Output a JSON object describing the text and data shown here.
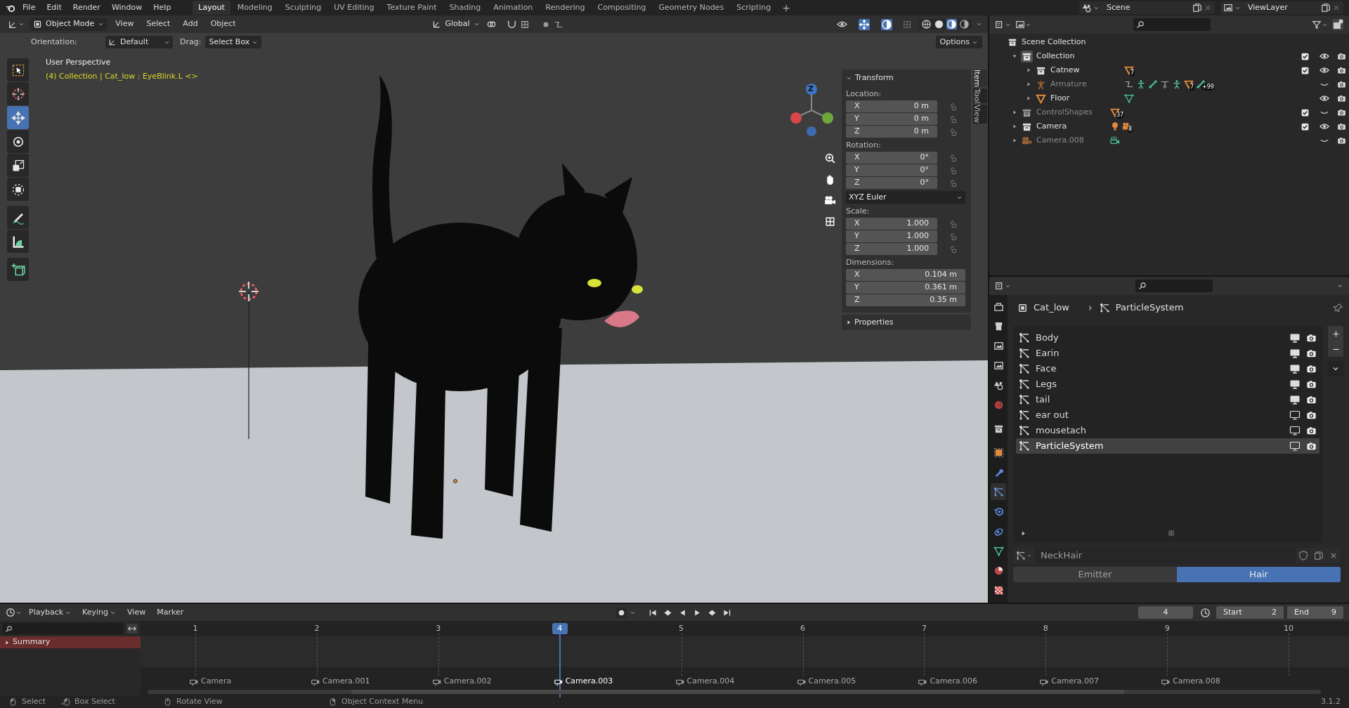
{
  "top_bar": {
    "menus": [
      "File",
      "Edit",
      "Render",
      "Window",
      "Help"
    ],
    "workspaces": [
      {
        "label": "Layout",
        "selected": true
      },
      {
        "label": "Modeling",
        "selected": false
      },
      {
        "label": "Sculpting",
        "selected": false
      },
      {
        "label": "UV Editing",
        "selected": false
      },
      {
        "label": "Texture Paint",
        "selected": false
      },
      {
        "label": "Shading",
        "selected": false
      },
      {
        "label": "Animation",
        "selected": false
      },
      {
        "label": "Rendering",
        "selected": false
      },
      {
        "label": "Compositing",
        "selected": false
      },
      {
        "label": "Geometry Nodes",
        "selected": false
      },
      {
        "label": "Scripting",
        "selected": false
      }
    ],
    "add_workspace": "+",
    "scene": "Scene",
    "view_layer": "ViewLayer"
  },
  "viewport_header": {
    "mode": "Object Mode",
    "menus": [
      "View",
      "Select",
      "Add",
      "Object"
    ],
    "transform_orientation": "Global"
  },
  "tool_settings": {
    "orientation_label": "Orientation:",
    "orientation": "Default",
    "drag_label": "Drag:",
    "drag": "Select Box",
    "options": "Options"
  },
  "toolbar": [
    {
      "kind": "select",
      "selected": false
    },
    {
      "kind": "cursor",
      "selected": false
    },
    {
      "kind": "move",
      "selected": true
    },
    {
      "kind": "rotate",
      "selected": false
    },
    {
      "kind": "scale",
      "selected": false
    },
    {
      "kind": "transform",
      "selected": false
    },
    {
      "kind": "annotate",
      "selected": false
    },
    {
      "kind": "measure",
      "selected": false
    },
    {
      "kind": "add-cube",
      "selected": false
    }
  ],
  "viewport": {
    "view_name": "User Perspective",
    "context": "(4) Collection | Cat_low : EyeBlink.L <>",
    "gizmo_axis_label": "Z"
  },
  "sidebar": {
    "tabs": [
      {
        "label": "Item",
        "selected": true
      },
      {
        "label": "Tool",
        "selected": false
      },
      {
        "label": "View",
        "selected": false
      }
    ],
    "panel_title": "Transform",
    "expanded": true,
    "groups": [
      {
        "label": "Location:",
        "lockable": true,
        "fields": [
          {
            "axis": "X",
            "value": "0 m"
          },
          {
            "axis": "Y",
            "value": "0 m"
          },
          {
            "axis": "Z",
            "value": "0 m"
          }
        ]
      },
      {
        "label": "Rotation:",
        "lockable": true,
        "fields": [
          {
            "axis": "X",
            "value": "0°"
          },
          {
            "axis": "Y",
            "value": "0°"
          },
          {
            "axis": "Z",
            "value": "0°"
          }
        ],
        "mode": "XYZ Euler"
      },
      {
        "label": "Scale:",
        "lockable": true,
        "fields": [
          {
            "axis": "X",
            "value": "1.000"
          },
          {
            "axis": "Y",
            "value": "1.000"
          },
          {
            "axis": "Z",
            "value": "1.000"
          }
        ]
      },
      {
        "label": "Dimensions:",
        "lockable": false,
        "fields": [
          {
            "axis": "X",
            "value": "0.104 m"
          },
          {
            "axis": "Y",
            "value": "0.361 m"
          },
          {
            "axis": "Z",
            "value": "0.35 m"
          }
        ]
      }
    ],
    "collapsed_panel": "Properties"
  },
  "outliner": {
    "root": "Scene Collection",
    "items": [
      {
        "name": "Collection",
        "kind": "collection",
        "expanded": true,
        "checked": true,
        "visible": true,
        "active": true,
        "children": [
          {
            "name": "Catnew",
            "kind": "collection",
            "expanded": false,
            "checked": true,
            "visible": true,
            "active": false,
            "badges": [
              {
                "kind": "mesh",
                "count": "7"
              }
            ]
          },
          {
            "name": "Armature",
            "kind": "armature",
            "expanded": false,
            "visible": false,
            "active": false,
            "badges": [
              {
                "kind": "curve"
              },
              {
                "kind": "pose"
              },
              {
                "kind": "bone"
              },
              {
                "kind": "constraint"
              },
              {
                "kind": "pose"
              },
              {
                "kind": "mesh",
                "count": "7"
              },
              {
                "kind": "bone",
                "count": "+99"
              }
            ]
          },
          {
            "name": "Floor",
            "kind": "mesh",
            "expanded": false,
            "visible": true,
            "active": false,
            "badges": [
              {
                "kind": "mesh-data"
              }
            ]
          }
        ]
      },
      {
        "name": "ControlShapes",
        "kind": "collection",
        "expanded": false,
        "checked": true,
        "visible": false,
        "active": false,
        "badges": [
          {
            "kind": "mesh",
            "count": "37"
          }
        ]
      },
      {
        "name": "Camera",
        "kind": "collection",
        "expanded": false,
        "checked": true,
        "visible": true,
        "active": false,
        "badges": [
          {
            "kind": "light"
          },
          {
            "kind": "camera",
            "count": "8"
          }
        ]
      },
      {
        "name": "Camera.008",
        "kind": "camera",
        "expanded": false,
        "visible": false,
        "active": false,
        "badges": [
          {
            "kind": "camera-data"
          }
        ]
      }
    ]
  },
  "properties": {
    "tabs": [
      {
        "kind": "tool",
        "selected": false
      },
      {
        "kind": "render",
        "selected": false
      },
      {
        "kind": "output",
        "selected": false
      },
      {
        "kind": "view-layer",
        "selected": false
      },
      {
        "kind": "scene",
        "selected": false
      },
      {
        "kind": "world",
        "selected": false
      },
      {
        "kind": "collection",
        "selected": false
      },
      {
        "kind": "object",
        "selected": false
      },
      {
        "kind": "modifier",
        "selected": false
      },
      {
        "kind": "particles",
        "selected": true
      },
      {
        "kind": "physics",
        "selected": false
      },
      {
        "kind": "constraint",
        "selected": false
      },
      {
        "kind": "data",
        "selected": false
      },
      {
        "kind": "material",
        "selected": false
      },
      {
        "kind": "texture",
        "selected": false
      }
    ],
    "object": "Cat_low",
    "datablock": "ParticleSystem",
    "systems": [
      {
        "name": "Body",
        "show_viewport": true,
        "selected": false
      },
      {
        "name": "Earin",
        "show_viewport": true,
        "selected": false
      },
      {
        "name": "Face",
        "show_viewport": true,
        "selected": false
      },
      {
        "name": "Legs",
        "show_viewport": true,
        "selected": false
      },
      {
        "name": "tail",
        "show_viewport": true,
        "selected": false
      },
      {
        "name": "ear out",
        "show_viewport": false,
        "selected": false
      },
      {
        "name": "mousetach",
        "show_viewport": false,
        "selected": false
      },
      {
        "name": "ParticleSystem",
        "show_viewport": false,
        "selected": true
      }
    ],
    "settings_name": "NeckHair",
    "types": [
      {
        "label": "Emitter",
        "selected": false
      },
      {
        "label": "Hair",
        "selected": true
      }
    ]
  },
  "timeline": {
    "menus": [
      "Playback",
      "Keying",
      "View",
      "Marker"
    ],
    "current_frame": "4",
    "start_label": "Start",
    "start": "2",
    "end_label": "End",
    "end": "9",
    "channel": "Summary",
    "frames": [
      {
        "label": "1",
        "selected": false
      },
      {
        "label": "2",
        "selected": false
      },
      {
        "label": "3",
        "selected": false
      },
      {
        "label": "4",
        "selected": true
      },
      {
        "label": "5",
        "selected": false
      },
      {
        "label": "6",
        "selected": false
      },
      {
        "label": "7",
        "selected": false
      },
      {
        "label": "8",
        "selected": false
      },
      {
        "label": "9",
        "selected": false
      },
      {
        "label": "10",
        "selected": false
      }
    ],
    "markers": [
      {
        "name": "Camera",
        "selected": false
      },
      {
        "name": "Camera.001",
        "selected": false
      },
      {
        "name": "Camera.002",
        "selected": false
      },
      {
        "name": "Camera.003",
        "selected": true
      },
      {
        "name": "Camera.004",
        "selected": false
      },
      {
        "name": "Camera.005",
        "selected": false
      },
      {
        "name": "Camera.006",
        "selected": false
      },
      {
        "name": "Camera.007",
        "selected": false
      },
      {
        "name": "Camera.008",
        "selected": false
      }
    ]
  },
  "status_bar": {
    "hints": [
      {
        "kind": "left",
        "label": "Select"
      },
      {
        "kind": "left-drag",
        "label": "Box Select"
      },
      {
        "kind": "middle",
        "label": "Rotate View"
      },
      {
        "kind": "right",
        "label": "Object Context Menu"
      }
    ],
    "version": "3.1.2"
  }
}
